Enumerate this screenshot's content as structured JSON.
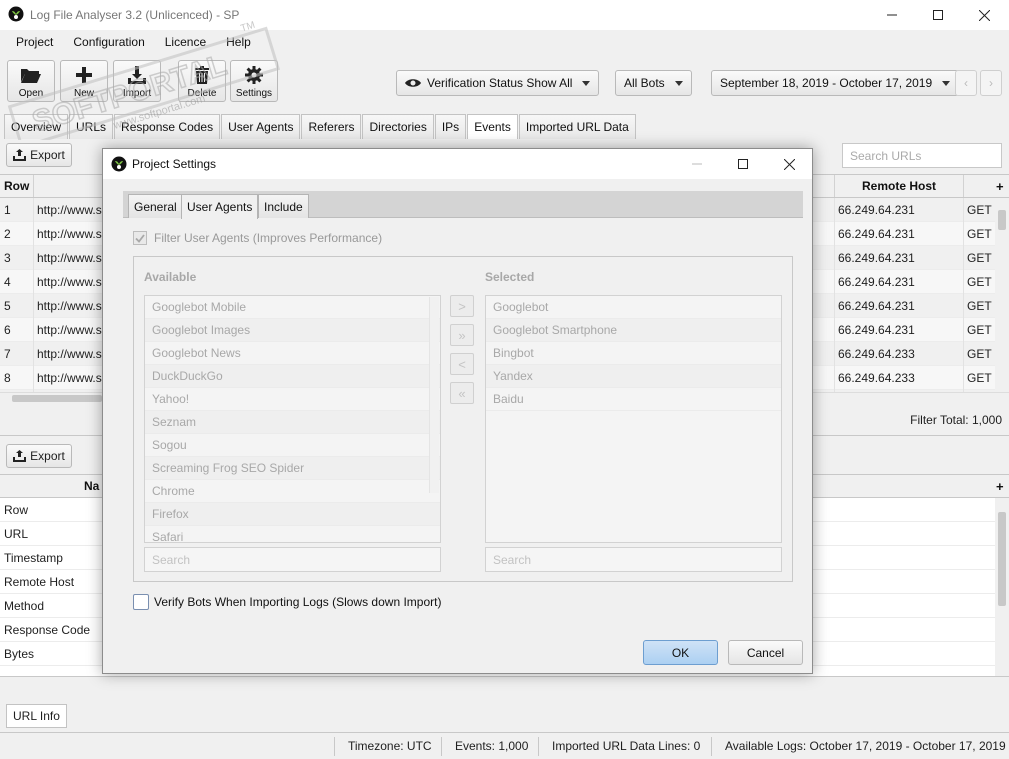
{
  "window": {
    "title": "Log File Analyser 3.2 (Unlicenced) - SP"
  },
  "menu": [
    "Project",
    "Configuration",
    "Licence",
    "Help"
  ],
  "toolbar": {
    "open": "Open",
    "new": "New",
    "import": "Import",
    "delete": "Delete",
    "settings": "Settings",
    "verification": "Verification Status Show All",
    "bots": "All Bots",
    "date_range": "September 18, 2019 - October 17, 2019"
  },
  "tabs": [
    "Overview",
    "URLs",
    "Response Codes",
    "User Agents",
    "Referers",
    "Directories",
    "IPs",
    "Events",
    "Imported URL Data"
  ],
  "active_tab": "Events",
  "export_label": "Export",
  "search_placeholder": "Search URLs",
  "grid": {
    "row_header": "Row",
    "remote_host_header": "Remote Host",
    "rows": [
      {
        "row": "1",
        "url": "http://www.s",
        "host": "66.249.64.231",
        "method": "GET"
      },
      {
        "row": "2",
        "url": "http://www.s",
        "host": "66.249.64.231",
        "method": "GET"
      },
      {
        "row": "3",
        "url": "http://www.s",
        "host": "66.249.64.231",
        "method": "GET"
      },
      {
        "row": "4",
        "url": "http://www.s",
        "host": "66.249.64.231",
        "method": "GET"
      },
      {
        "row": "5",
        "url": "http://www.s",
        "host": "66.249.64.231",
        "method": "GET"
      },
      {
        "row": "6",
        "url": "http://www.s",
        "host": "66.249.64.231",
        "method": "GET"
      },
      {
        "row": "7",
        "url": "http://www.s",
        "host": "66.249.64.233",
        "method": "GET"
      },
      {
        "row": "8",
        "url": "http://www.s",
        "host": "66.249.64.233",
        "method": "GET"
      }
    ],
    "filter_total": "Filter Total: 1,000"
  },
  "lower": {
    "name_header": "Na",
    "rows": [
      "Row",
      "URL",
      "Timestamp",
      "Remote Host",
      "Method",
      "Response Code",
      "Bytes"
    ]
  },
  "bottom_tab": "URL Info",
  "status": {
    "timezone_label": "Timezone:",
    "timezone": "UTC",
    "events_label": "Events:",
    "events": "1,000",
    "imported_label": "Imported URL Data Lines:",
    "imported": "0",
    "available_label": "Available Logs:",
    "available": "October 17, 2019 - October 17, 2019"
  },
  "watermark": {
    "brand": "SOFTPORTAL",
    "url": "www.softportal.com",
    "tm": "TM"
  },
  "dialog": {
    "title": "Project Settings",
    "tabs": [
      "General",
      "User Agents",
      "Include"
    ],
    "active_tab": "User Agents",
    "filter_checkbox": "Filter User Agents (Improves Performance)",
    "filter_checked": true,
    "available_title": "Available",
    "selected_title": "Selected",
    "available": [
      "Googlebot Mobile",
      "Googlebot Images",
      "Googlebot News",
      "DuckDuckGo",
      "Yahoo!",
      "Seznam",
      "Sogou",
      "Screaming Frog SEO Spider",
      "Chrome",
      "Firefox",
      "Safari"
    ],
    "selected": [
      "Googlebot",
      "Googlebot Smartphone",
      "Bingbot",
      "Yandex",
      "Baidu"
    ],
    "search_placeholder": "Search",
    "arrows": [
      ">",
      "»",
      "<",
      "«"
    ],
    "verify_checkbox": "Verify Bots When Importing Logs (Slows down Import)",
    "verify_checked": false,
    "ok": "OK",
    "cancel": "Cancel"
  }
}
